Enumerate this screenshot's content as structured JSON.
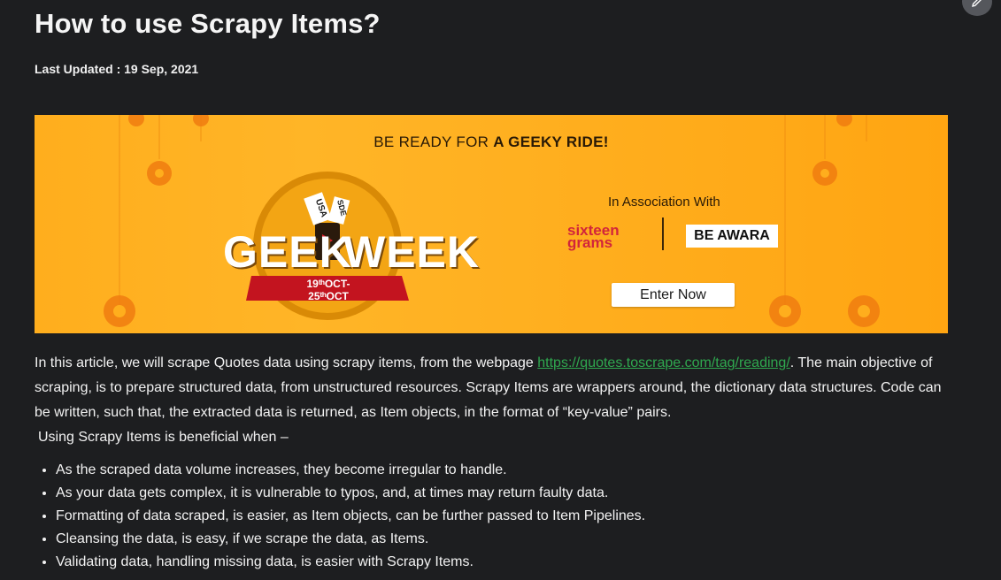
{
  "article": {
    "title": "How to use Scrapy Items?",
    "last_updated": "Last Updated : 19 Sep, 2021",
    "intro_before_link": "In this article, we will scrape Quotes data using scrapy items, from the webpage ",
    "link_text": "https://quotes.toscrape.com/tag/reading/",
    "intro_after_link": ". The main objective of scraping, is to prepare structured data, from unstructured resources. Scrapy Items are wrappers around, the dictionary data structures. Code can be written, such that, the extracted data is returned, as Item objects, in the format of “key-value” pairs.",
    "lead": "Using Scrapy Items is beneficial when –",
    "benefits": [
      "As the scraped data volume increases, they become irregular to handle.",
      "As your data gets complex, it is vulnerable to typos, and, at times may return faulty data.",
      "Formatting of data scraped, is easier, as Item objects, can be further passed to Item Pipelines.",
      "Cleansing the data, is easy, if we scrape the data, as Items.",
      "Validating data, handling missing data, is easier with Scrapy Items."
    ]
  },
  "banner": {
    "headline_prefix": "BE READY FOR ",
    "headline_bold": "A GEEKY RIDE!",
    "logo_word_left": "GEEK",
    "logo_word_right": "WEEK",
    "dates": "19ᵗʰOCT-25ᵗʰOCT",
    "ticket_labels": [
      "USA",
      "SDE"
    ],
    "association_text": "In Association With",
    "sponsor_1_line1": "sixteen",
    "sponsor_1_line2": "grams",
    "sponsor_2": "BE AWARA",
    "cta_label": "Enter Now",
    "background_color": "#ffae1d"
  },
  "toolbar": {
    "edit_icon": "pencil-icon"
  },
  "colors": {
    "page_background": "#1d1e20",
    "link": "#2fa84f",
    "text": "#f2f2f2"
  }
}
